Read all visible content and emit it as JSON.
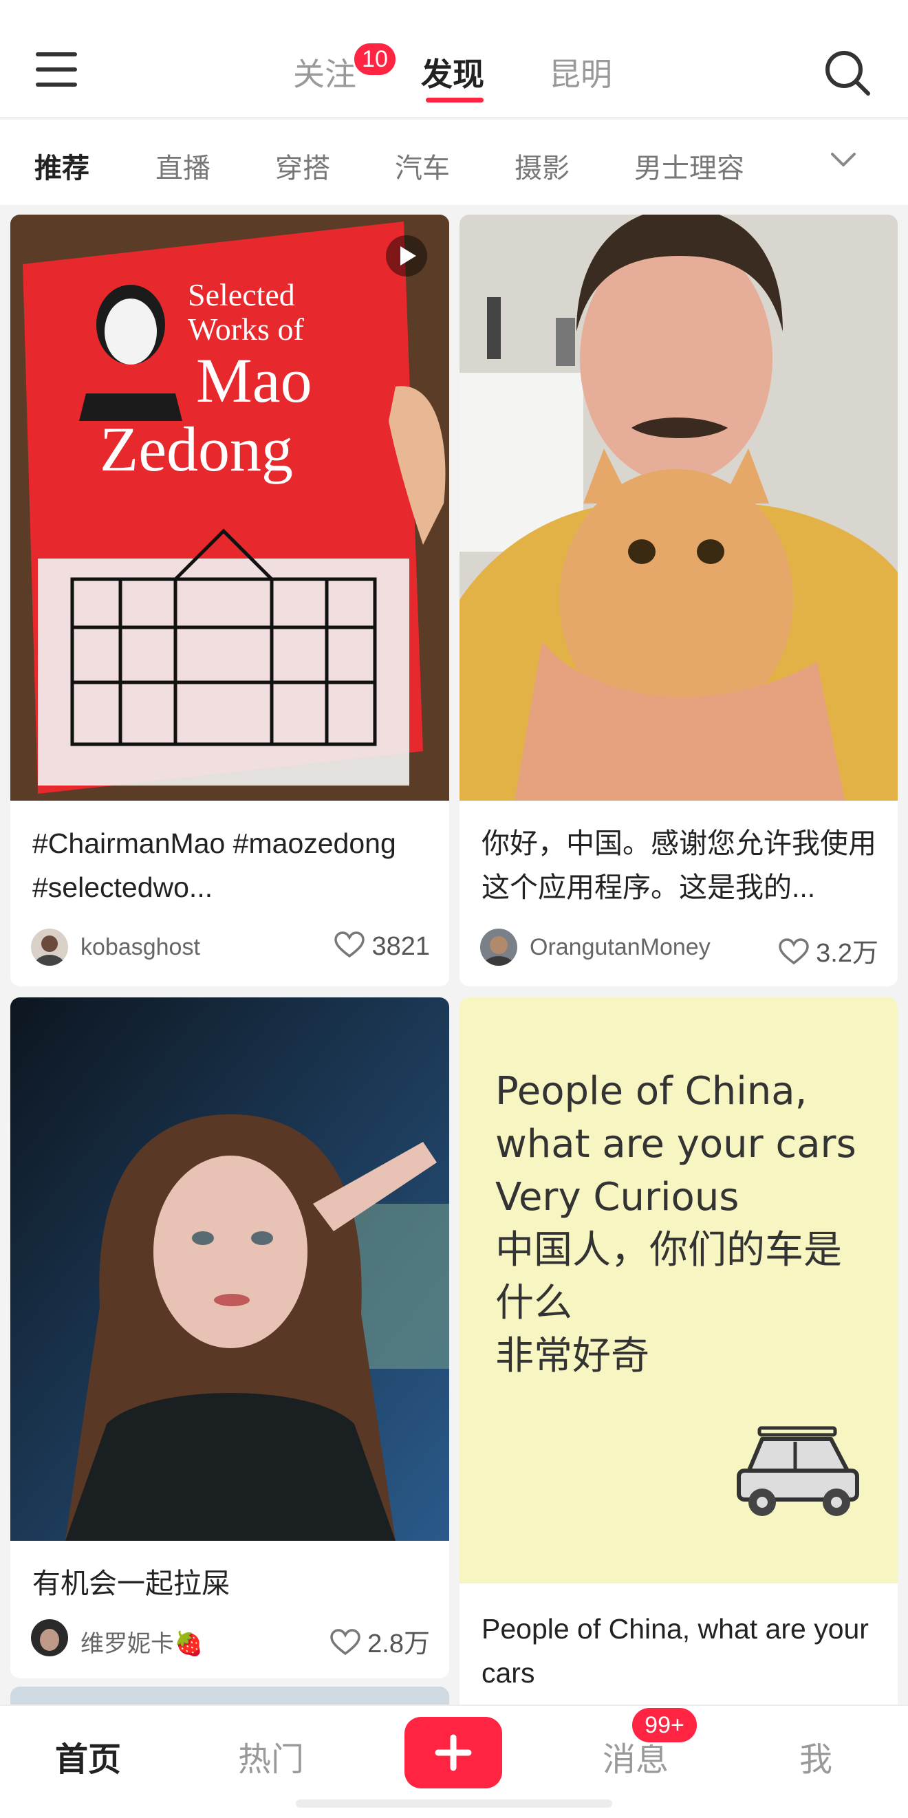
{
  "header": {
    "tabs": [
      {
        "label": "关注",
        "badge": "10"
      },
      {
        "label": "发现",
        "active": true
      },
      {
        "label": "昆明"
      }
    ],
    "menu_icon": "hamburger-menu-icon",
    "search_icon": "search-icon"
  },
  "categories": {
    "items": [
      "推荐",
      "直播",
      "穿搭",
      "汽车",
      "摄影",
      "男士理容"
    ],
    "active": "推荐",
    "more_icon": "chevron-down-icon"
  },
  "feed": {
    "cards": [
      {
        "title": "#ChairmanMao #maozedong #selectedwo...",
        "author": "kobasghost",
        "likes": "3821",
        "has_video": true,
        "cover_text": {
          "line1": "Selected",
          "line2": "Works of",
          "line3": "Mao",
          "line4": "Zedong"
        }
      },
      {
        "title": "你好，中国。感谢您允许我使用这个应用程序。这是我的...",
        "author": "OrangutanMoney",
        "likes": "3.2万"
      },
      {
        "title": "有机会一起拉屎",
        "author": "维罗妮卡🍓",
        "likes": "2.8万"
      },
      {
        "title": "People of China, what are your cars",
        "cover_lines": [
          "People of China,",
          "what are your cars",
          "Very Curious",
          "中国人，你们的车是",
          "什么",
          "非常好奇"
        ]
      }
    ]
  },
  "bottom_nav": {
    "items": [
      "首页",
      "热门",
      "消息",
      "我"
    ],
    "active": "首页",
    "messages_badge": "99+"
  },
  "colors": {
    "accent": "#ff2442",
    "cover_yellow": "#f7f5c2"
  }
}
